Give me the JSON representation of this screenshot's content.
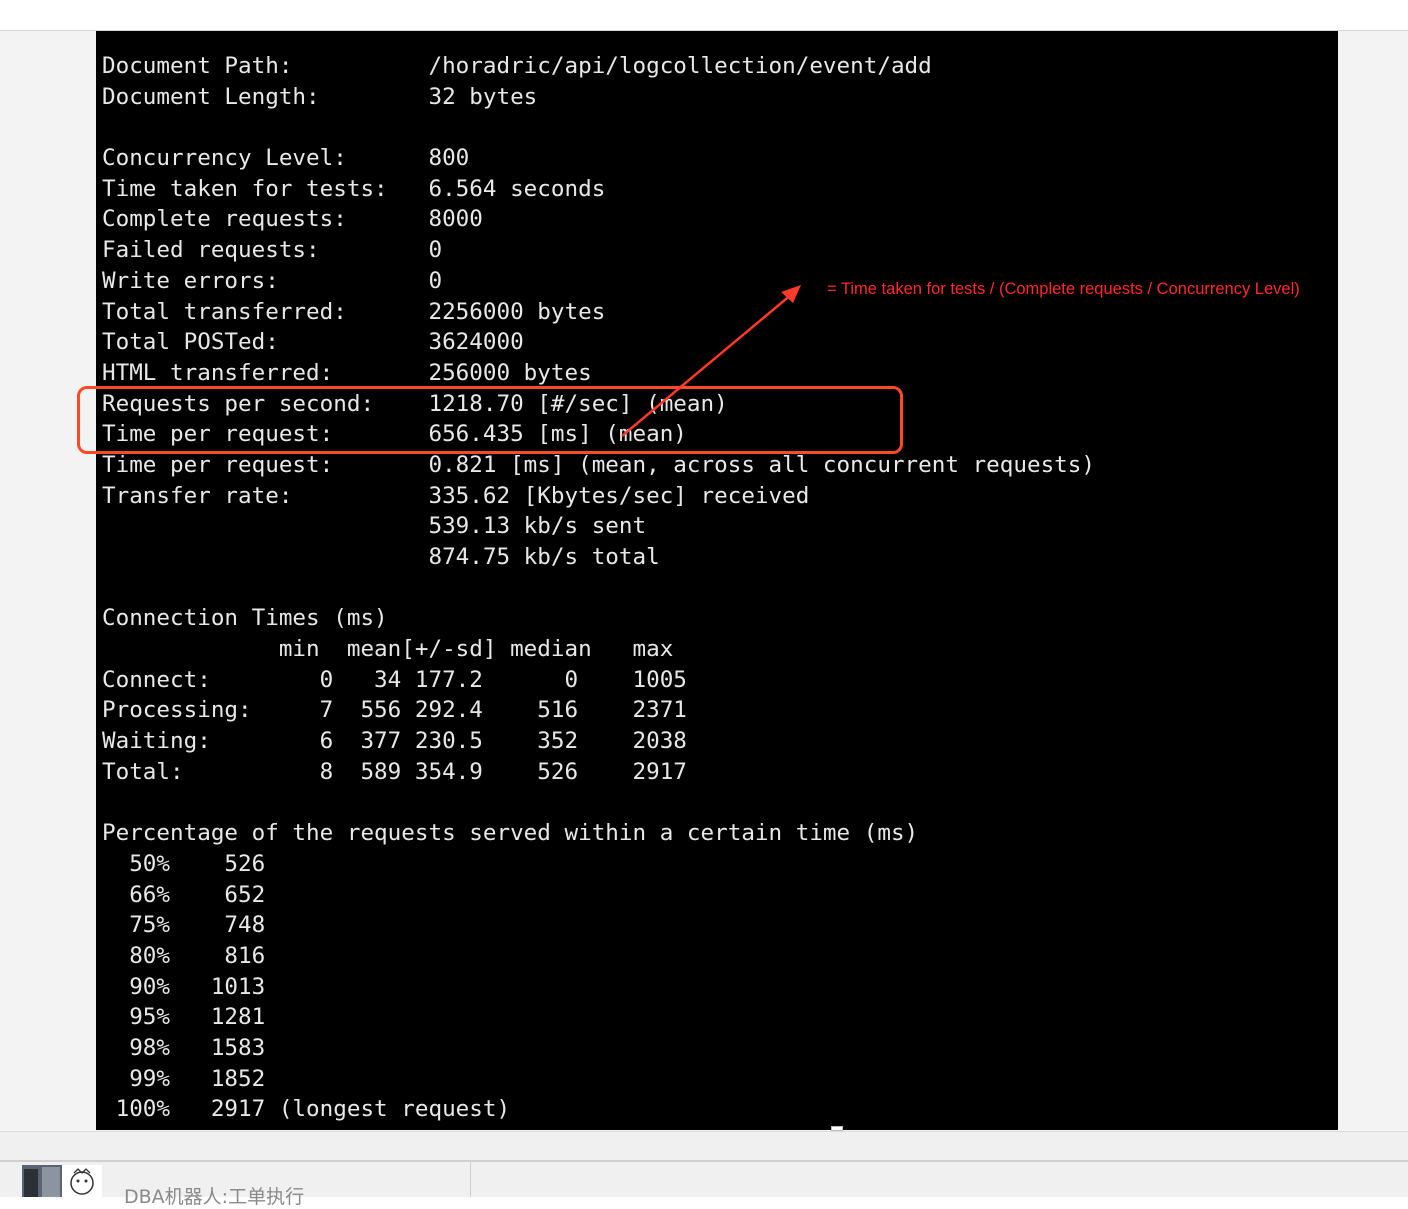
{
  "terminal": {
    "lines": [
      "Document Path:          /horadric/api/logcollection/event/add",
      "Document Length:        32 bytes",
      "",
      "Concurrency Level:      800",
      "Time taken for tests:   6.564 seconds",
      "Complete requests:      8000",
      "Failed requests:        0",
      "Write errors:           0",
      "Total transferred:      2256000 bytes",
      "Total POSTed:           3624000",
      "HTML transferred:       256000 bytes",
      "Requests per second:    1218.70 [#/sec] (mean)",
      "Time per request:       656.435 [ms] (mean)",
      "Time per request:       0.821 [ms] (mean, across all concurrent requests)",
      "Transfer rate:          335.62 [Kbytes/sec] received",
      "                        539.13 kb/s sent",
      "                        874.75 kb/s total",
      "",
      "Connection Times (ms)",
      "             min  mean[+/-sd] median   max",
      "Connect:        0   34 177.2      0    1005",
      "Processing:     7  556 292.4    516    2371",
      "Waiting:        6  377 230.5    352    2038",
      "Total:          8  589 354.9    526    2917",
      "",
      "Percentage of the requests served within a certain time (ms)",
      "  50%    526",
      "  66%    652",
      "  75%    748",
      "  80%    816",
      "  90%   1013",
      "  95%   1281",
      "  98%   1583",
      "  99%   1852",
      " 100%   2917 (longest request)"
    ]
  },
  "annotation": {
    "note": "= Time taken for tests / (Complete requests / Concurrency Level)",
    "color": "#ff2a2a",
    "box_color": "#ff4a24"
  },
  "taskbar": {
    "label": "DBA机器人:工单执行",
    "avatar_icon": "user-avatar-icon"
  }
}
